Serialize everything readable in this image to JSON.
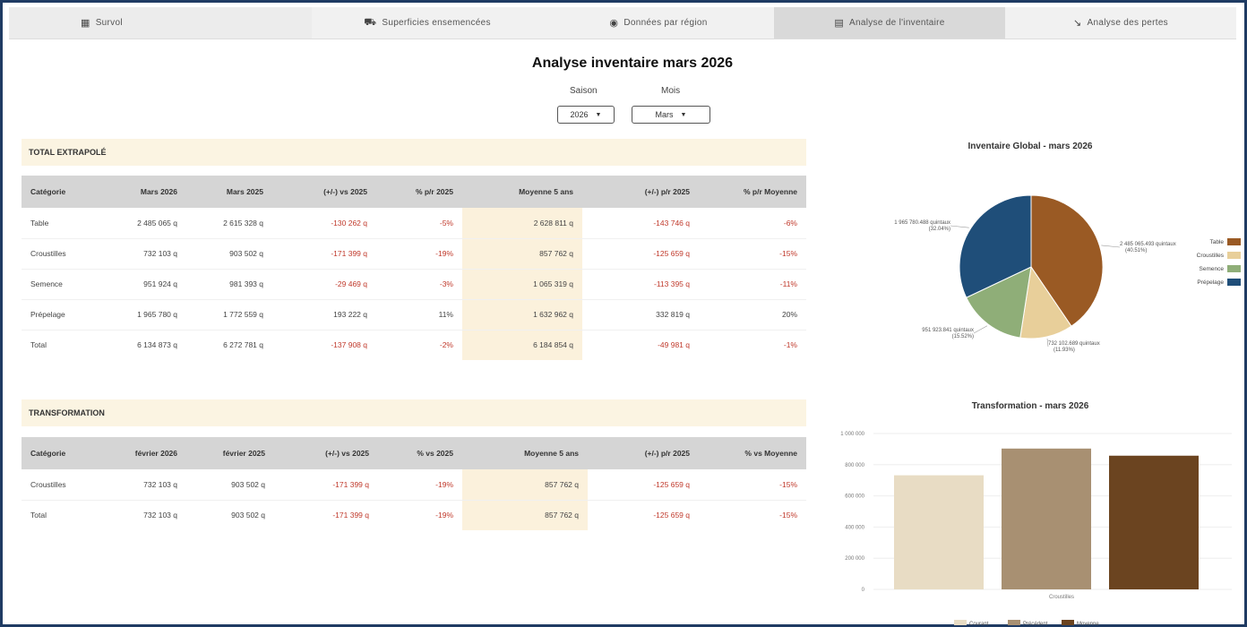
{
  "tabs": [
    {
      "label": "Survol",
      "icon": "dashboard-icon"
    },
    {
      "label": "Superficies ensemencées",
      "icon": "tractor-icon"
    },
    {
      "label": "Données par région",
      "icon": "globe-icon"
    },
    {
      "label": "Analyse de l'inventaire",
      "icon": "warehouse-icon",
      "active": true
    },
    {
      "label": "Analyse des pertes",
      "icon": "trend-down-icon"
    }
  ],
  "header": {
    "title": "Analyse inventaire mars 2026",
    "season_label": "Saison",
    "season_value": "2026",
    "month_label": "Mois",
    "month_value": "Mars"
  },
  "extrapole": {
    "title": "TOTAL EXTRAPOLÉ",
    "columns": [
      "Catégorie",
      "Mars 2026",
      "Mars 2025",
      "(+/-) vs 2025",
      "% p/r 2025",
      "Moyenne 5 ans",
      "(+/-) p/r 2025",
      "% p/r Moyenne"
    ],
    "rows": [
      [
        "Table",
        "2 485 065 q",
        "2 615 328 q",
        "-130 262 q",
        "-5%",
        "2 628 811 q",
        "-143 746 q",
        "-6%"
      ],
      [
        "Croustilles",
        "732 103 q",
        "903 502 q",
        "-171 399 q",
        "-19%",
        "857 762 q",
        "-125 659 q",
        "-15%"
      ],
      [
        "Semence",
        "951 924 q",
        "981 393 q",
        "-29 469 q",
        "-3%",
        "1 065 319 q",
        "-113 395 q",
        "-11%"
      ],
      [
        "Prépelage",
        "1 965 780 q",
        "1 772 559 q",
        "193 222 q",
        "11%",
        "1 632 962 q",
        "332 819 q",
        "20%"
      ],
      [
        "Total",
        "6 134 873 q",
        "6 272 781 q",
        "-137 908 q",
        "-2%",
        "6 184 854 q",
        "-49 981 q",
        "-1%"
      ]
    ]
  },
  "transformation": {
    "title": "TRANSFORMATION",
    "columns": [
      "Catégorie",
      "février 2026",
      "février 2025",
      "(+/-) vs 2025",
      "% vs 2025",
      "Moyenne 5 ans",
      "(+/-) p/r 2025",
      "% vs Moyenne"
    ],
    "rows": [
      [
        "Croustilles",
        "732 103 q",
        "903 502 q",
        "-171 399 q",
        "-19%",
        "857 762 q",
        "-125 659 q",
        "-15%"
      ],
      [
        "Total",
        "732 103 q",
        "903 502 q",
        "-171 399 q",
        "-19%",
        "857 762 q",
        "-125 659 q",
        "-15%"
      ]
    ]
  },
  "chart_data": [
    {
      "type": "pie",
      "title": "Inventaire Global - mars 2026",
      "categories": [
        "Table",
        "Croustilles",
        "Semence",
        "Prépelage"
      ],
      "values": [
        2485065.493,
        732102.689,
        951923.841,
        1965780.488
      ],
      "labels": [
        "2 485 065.493 quintaux (40.51%)",
        "732 102.689 quintaux (11.93%)",
        "951 923.841 quintaux (15.52%)",
        "1 965 780.488 quintaux (32.04%)"
      ],
      "colors": [
        "#9a5a24",
        "#e8cf9a",
        "#8fae78",
        "#1f4e79"
      ],
      "legend_position": "right"
    },
    {
      "type": "bar",
      "title": "Transformation - mars 2026",
      "categories": [
        "Croustilles"
      ],
      "series": [
        {
          "name": "Courant",
          "values": [
            732103
          ],
          "color": "#e8dcc4"
        },
        {
          "name": "Précédent",
          "values": [
            903502
          ],
          "color": "#a89072"
        },
        {
          "name": "Moyenne",
          "values": [
            857762
          ],
          "color": "#6b4420"
        }
      ],
      "y_ticks": [
        "0",
        "200 000",
        "400 000",
        "600 000",
        "800 000",
        "1 000 000"
      ],
      "ylim": [
        0,
        1000000
      ],
      "grid": true,
      "legend_position": "bottom"
    }
  ]
}
